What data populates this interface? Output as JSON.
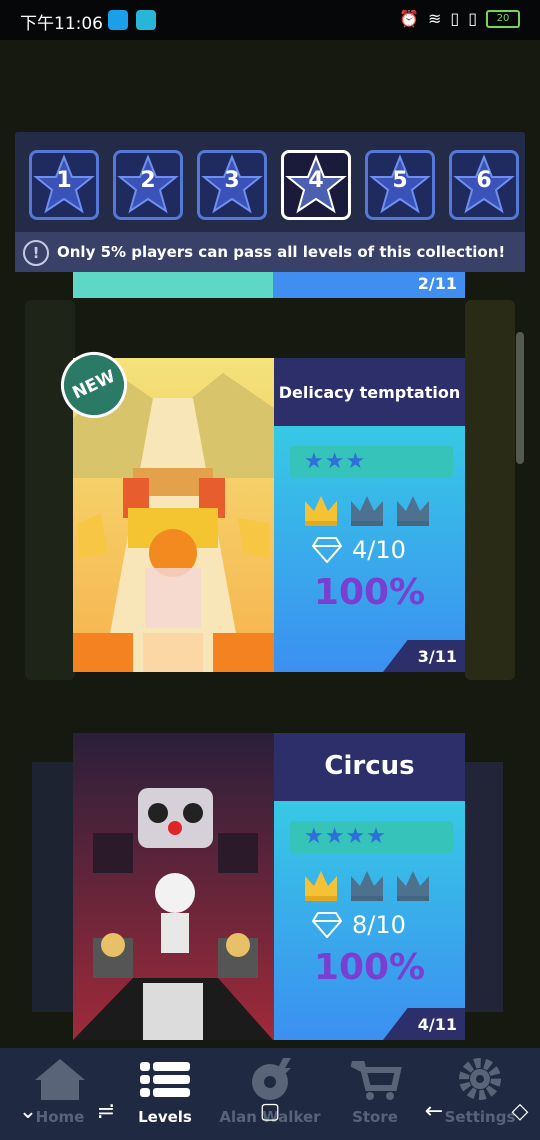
{
  "status_bar": {
    "time": "下午11:06",
    "battery": "20"
  },
  "collection": {
    "tabs": [
      "1",
      "2",
      "3",
      "4",
      "5",
      "6"
    ],
    "active_tab": "4",
    "notice": "Only 5%  players can pass all levels of this collection!"
  },
  "prev_level": {
    "count": "2/11"
  },
  "levels": [
    {
      "badge": "NEW",
      "title": "Delicacy temptation",
      "stars": "★★★",
      "gems": "4/10",
      "percent": "100%",
      "count": "3/11"
    },
    {
      "title": "Circus",
      "stars": "★★★★",
      "gems": "8/10",
      "percent": "100%",
      "count": "4/11"
    }
  ],
  "nav": {
    "home": "Home",
    "levels": "Levels",
    "alan_walker": "Alan Walker",
    "store": "Store",
    "settings": "Settings"
  },
  "colors": {
    "accent_blue": "#5577d6",
    "crown_gold": "#f5c236",
    "crown_grey": "#4f7190",
    "percent_purple": "#7a3fd0"
  }
}
